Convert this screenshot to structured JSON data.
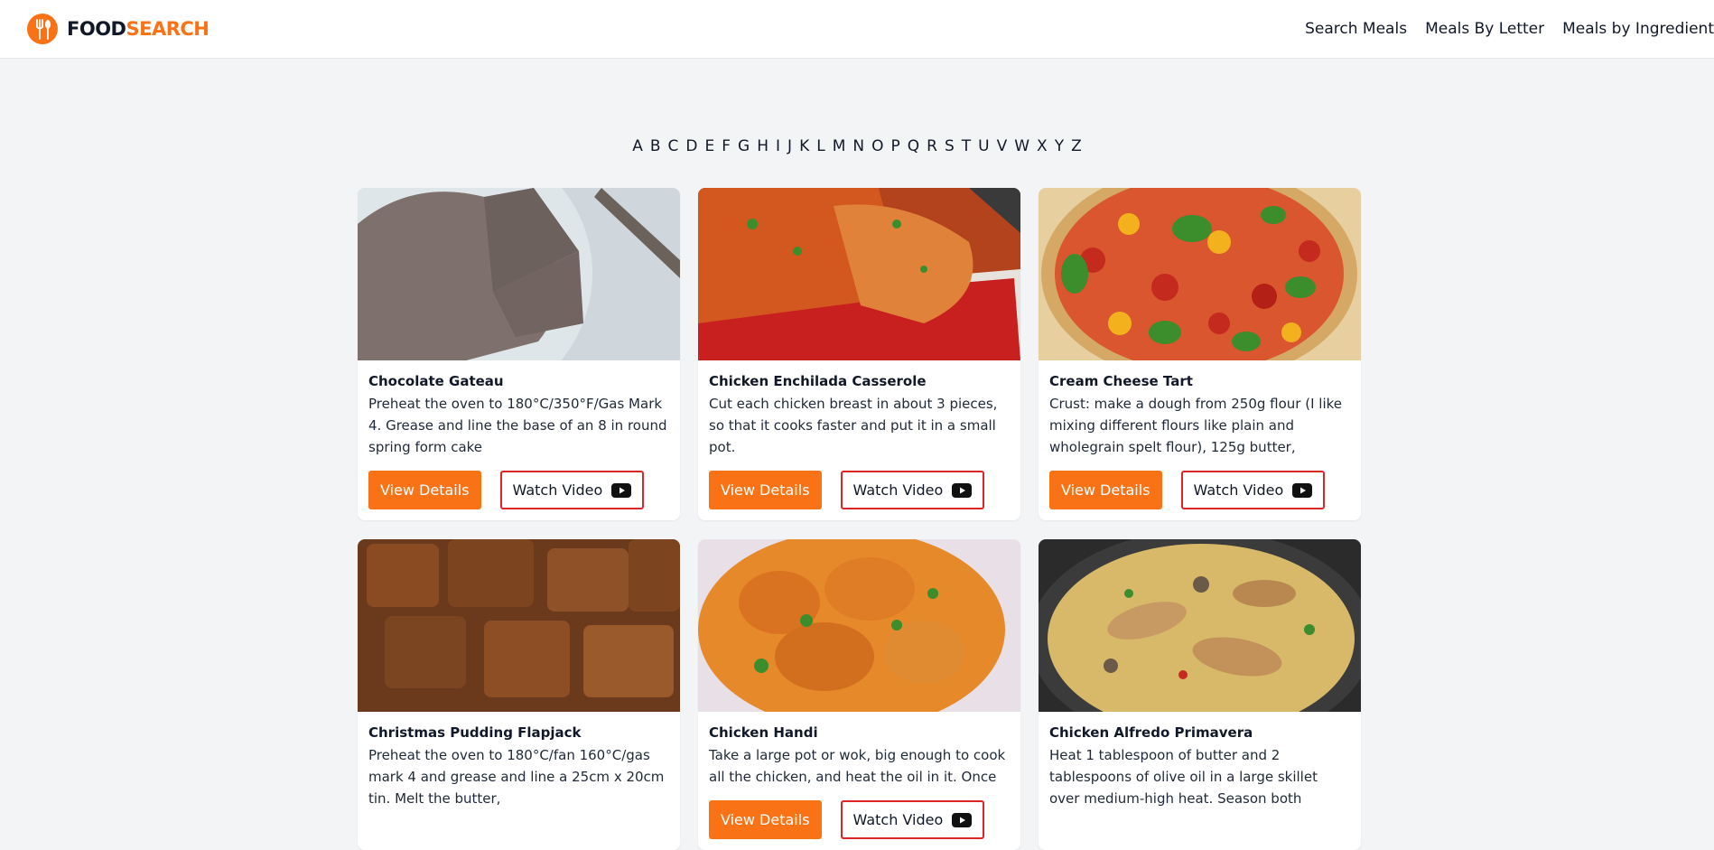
{
  "brand": {
    "word1": "FOOD",
    "word2": "SEARCH"
  },
  "nav": [
    "Search Meals",
    "Meals By Letter",
    "Meals by Ingredient"
  ],
  "letters": [
    "A",
    "B",
    "C",
    "D",
    "E",
    "F",
    "G",
    "H",
    "I",
    "J",
    "K",
    "L",
    "M",
    "N",
    "O",
    "P",
    "Q",
    "R",
    "S",
    "T",
    "U",
    "V",
    "W",
    "X",
    "Y",
    "Z"
  ],
  "buttons": {
    "details": "View Details",
    "video": "Watch Video"
  },
  "colors": {
    "accent": "#f97316",
    "video_border": "#dc2626",
    "background": "#f3f4f6"
  },
  "meals": [
    {
      "title": "Chocolate Gateau",
      "desc": "Preheat the oven to 180°C/350°F/Gas Mark 4. Grease and line the base of an 8 in round spring form cake"
    },
    {
      "title": "Chicken Enchilada Casserole",
      "desc": "Cut each chicken breast in about 3 pieces, so that it cooks faster and put it in a small pot."
    },
    {
      "title": "Cream Cheese Tart",
      "desc": "Crust: make a dough from 250g flour (I like mixing different flours like plain and wholegrain spelt flour), 125g butter,"
    },
    {
      "title": "Christmas Pudding Flapjack",
      "desc": "Preheat the oven to 180°C/fan 160°C/gas mark 4 and grease and line a 25cm x 20cm tin. Melt the butter,"
    },
    {
      "title": "Chicken Handi",
      "desc": "Take a large pot or wok, big enough to cook all the chicken, and heat the oil in it. Once"
    },
    {
      "title": "Chicken Alfredo Primavera",
      "desc": "Heat 1 tablespoon of butter and 2 tablespoons of olive oil in a large skillet over medium-high heat. Season both"
    }
  ]
}
